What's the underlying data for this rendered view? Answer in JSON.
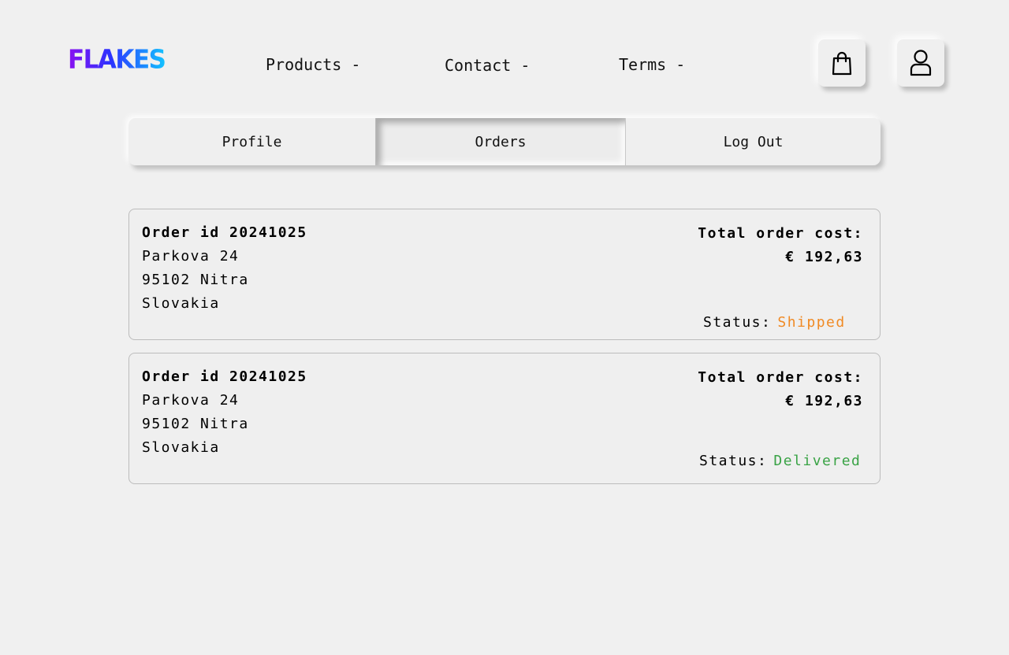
{
  "header": {
    "logo": "FLAKES",
    "nav": [
      "Products -",
      "Contact -",
      "Terms -"
    ],
    "cart_icon": "shopping-bag-icon",
    "user_icon": "user-icon"
  },
  "tabs": [
    {
      "label": "Profile",
      "active": false
    },
    {
      "label": "Orders",
      "active": true
    },
    {
      "label": "Log Out",
      "active": false
    }
  ],
  "orders": [
    {
      "id_text": "Order id 20241025",
      "address": [
        "Parkova 24",
        "95102 Nitra",
        "Slovakia"
      ],
      "total_label": "Total order cost:",
      "total_value": "€ 192,63",
      "status_label": "Status:",
      "status_value": "Shipped",
      "status_color": "#f08a24"
    },
    {
      "id_text": "Order id 20241025",
      "address": [
        "Parkova 24",
        "95102 Nitra",
        "Slovakia"
      ],
      "total_label": "Total order cost:",
      "total_value": "€ 192,63",
      "status_label": "Status:",
      "status_value": "Delivered",
      "status_color": "#3aa346"
    }
  ]
}
